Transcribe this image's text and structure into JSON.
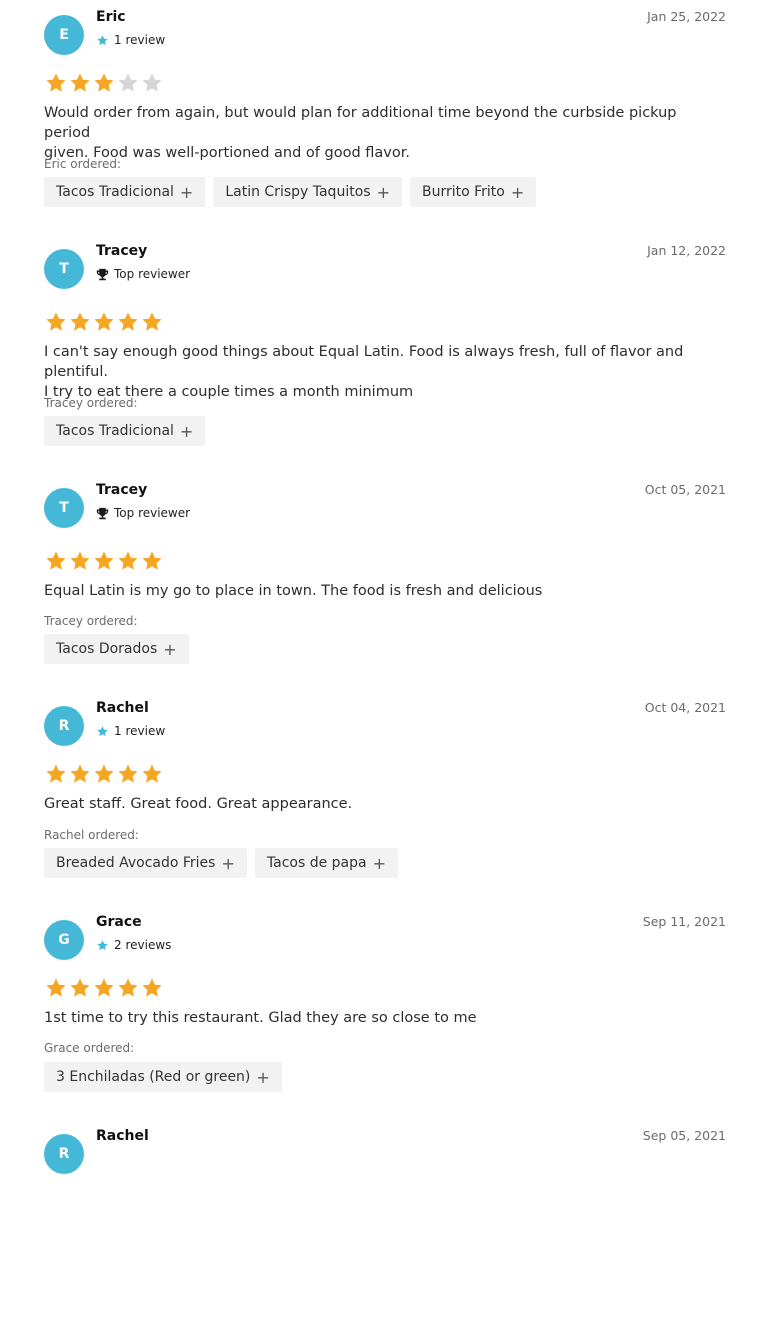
{
  "reviews": [
    {
      "initial": "E",
      "name": "Eric",
      "badge_type": "star",
      "badge_text": "1 review",
      "date": "Jan 25, 2022",
      "rating": 3,
      "text_lines": [
        "Would order from again, but would plan for additional time beyond the curbside pickup period",
        "given. Food was well-portioned and of good flavor."
      ],
      "ordered_label": "Eric ordered:",
      "items": [
        "Tacos Tradicional",
        "Latin Crispy Taquitos",
        "Burrito Frito"
      ]
    },
    {
      "initial": "T",
      "name": "Tracey",
      "badge_type": "trophy",
      "badge_text": "Top reviewer",
      "date": "Jan 12, 2022",
      "rating": 5,
      "text_lines": [
        "I can't say enough good things about Equal Latin. Food is always fresh, full of flavor and plentiful.",
        "I try to eat there a couple times a month minimum"
      ],
      "ordered_label": "Tracey ordered:",
      "items": [
        "Tacos Tradicional"
      ]
    },
    {
      "initial": "T",
      "name": "Tracey",
      "badge_type": "trophy",
      "badge_text": "Top reviewer",
      "date": "Oct 05, 2021",
      "rating": 5,
      "text_lines": [
        "Equal Latin is my go to place in town. The food is fresh and delicious"
      ],
      "ordered_label": "Tracey ordered:",
      "items": [
        "Tacos Dorados"
      ]
    },
    {
      "initial": "R",
      "name": "Rachel",
      "badge_type": "star",
      "badge_text": "1 review",
      "date": "Oct 04, 2021",
      "rating": 5,
      "text_lines": [
        "Great staff. Great food. Great appearance."
      ],
      "ordered_label": "Rachel ordered:",
      "items": [
        "Breaded Avocado Fries",
        "Tacos de papa"
      ]
    },
    {
      "initial": "G",
      "name": "Grace",
      "badge_type": "star",
      "badge_text": "2 reviews",
      "date": "Sep 11, 2021",
      "rating": 5,
      "text_lines": [
        "1st time to try this restaurant. Glad they are so close to me"
      ],
      "ordered_label": "Grace ordered:",
      "items": [
        "3 Enchiladas (Red or green)"
      ]
    },
    {
      "initial": "R",
      "name": "Rachel",
      "badge_type": "",
      "badge_text": "",
      "date": "Sep 05, 2021",
      "rating": 0,
      "text_lines": [],
      "ordered_label": "",
      "items": []
    }
  ],
  "colors": {
    "avatar": "#45b8d8",
    "star_filled": "#f5a623",
    "star_empty": "#d6d6d6",
    "badge_star": "#45b8d8"
  },
  "icons": {
    "filled_star": "star-icon",
    "empty_star": "star-empty-icon",
    "trophy": "trophy-icon",
    "plus": "plus-icon"
  }
}
